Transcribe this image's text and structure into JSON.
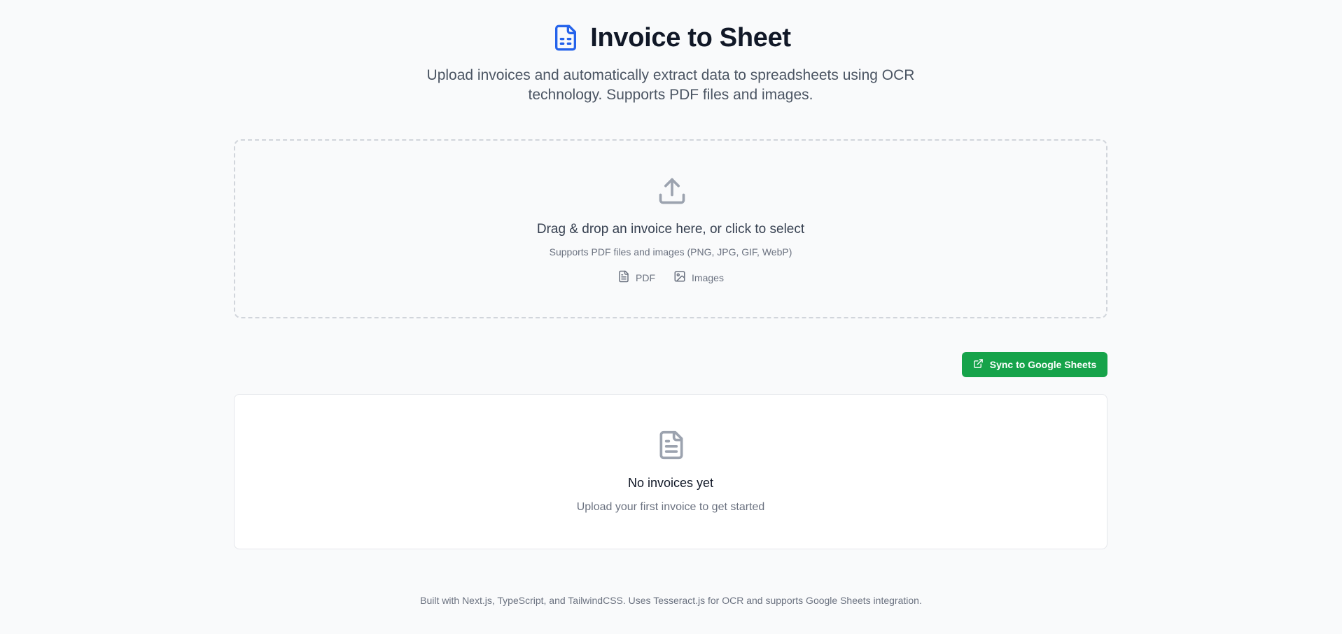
{
  "header": {
    "title": "Invoice to Sheet",
    "subtitle": "Upload invoices and automatically extract data to spreadsheets using OCR technology. Supports PDF files and images."
  },
  "dropzone": {
    "title": "Drag & drop an invoice here, or click to select",
    "hint": "Supports PDF files and images (PNG, JPG, GIF, WebP)",
    "types": [
      "PDF",
      "Images"
    ]
  },
  "actions": {
    "sync_label": "Sync to Google Sheets"
  },
  "invoices": {
    "empty_title": "No invoices yet",
    "empty_subtitle": "Upload your first invoice to get started"
  },
  "footer": {
    "text": "Built with Next.js, TypeScript, and TailwindCSS. Uses Tesseract.js for OCR and supports Google Sheets integration."
  },
  "icons": {
    "logo": "file-spreadsheet-icon",
    "upload": "upload-icon",
    "pdf": "file-text-icon",
    "images": "image-icon",
    "sync": "external-link-icon",
    "empty": "file-text-icon"
  },
  "colors": {
    "accent": "#2563eb",
    "sync_button": "#16a34a",
    "background": "#f9fafb",
    "icon_gray": "#9ca3af"
  }
}
